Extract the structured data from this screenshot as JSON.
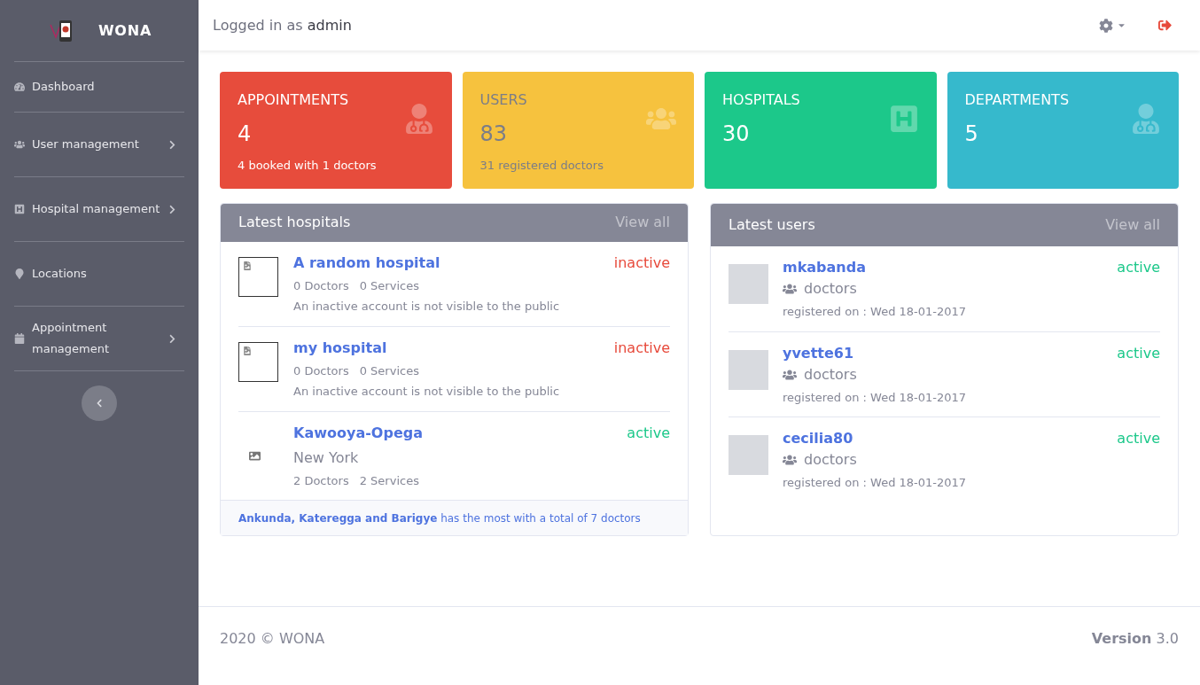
{
  "sidebar": {
    "brand": "WONA",
    "items": [
      {
        "label": "Dashboard",
        "kind": "gauge",
        "has_submenu": false
      },
      {
        "label": "User management",
        "kind": "users",
        "has_submenu": true
      },
      {
        "label": "Hospital management",
        "kind": "hospital",
        "has_submenu": true
      },
      {
        "label": "Locations",
        "kind": "pin",
        "has_submenu": false
      },
      {
        "label": "Appointment management",
        "kind": "calendar",
        "has_submenu": true
      }
    ]
  },
  "header": {
    "prefix": "Logged in as",
    "user": "admin"
  },
  "stat_cards": [
    {
      "kind": "appointments",
      "title": "APPOINTMENTS",
      "value": "4",
      "note": "4 booked with 1 doctors",
      "color": "#e74c3c"
    },
    {
      "kind": "users",
      "title": "USERS",
      "value": "83",
      "note": "31 registered doctors",
      "color": "#f6c23e"
    },
    {
      "kind": "hospitals",
      "title": "HOSPITALS",
      "value": "30",
      "color": "#1cc88a"
    },
    {
      "kind": "departments",
      "title": "DEPARTMENTS",
      "value": "5",
      "color": "#36b9cc"
    }
  ],
  "hospitals_panel": {
    "title": "Latest hospitals",
    "view_all": "View all",
    "items": [
      {
        "name": "A random hospital",
        "kind": "broken",
        "doctors": "0 Doctors",
        "services": "0 Services",
        "note": "An inactive account is not visible to the public",
        "status": "inactive",
        "active": false
      },
      {
        "name": "my hospital",
        "kind": "broken",
        "doctors": "0 Doctors",
        "services": "0 Services",
        "note": "An inactive account is not visible to the public",
        "status": "inactive",
        "active": false
      },
      {
        "name": "Kawooya-Opega",
        "kind": "placeholder",
        "location": "New York",
        "doctors": "2 Doctors",
        "services": "2 Services",
        "status": "active",
        "active": true
      }
    ],
    "footer": "**Ankunda, Kateregga and Barigye** has the most with a total of 7 doctors"
  },
  "users_panel": {
    "title": "Latest users",
    "view_all": "View all",
    "items": [
      {
        "name": "mkabanda",
        "group": "doctors",
        "registered": "registered on : Wed 18-01-2017",
        "status": "active",
        "active": true
      },
      {
        "name": "yvette61",
        "group": "doctors",
        "registered": "registered on : Wed 18-01-2017",
        "status": "active",
        "active": true
      },
      {
        "name": "cecilia80",
        "group": "doctors",
        "registered": "registered on : Wed 18-01-2017",
        "status": "active",
        "active": true
      }
    ]
  },
  "page_footer": {
    "copyright": "2020 © WONA",
    "version": "**Version** 3.0"
  }
}
